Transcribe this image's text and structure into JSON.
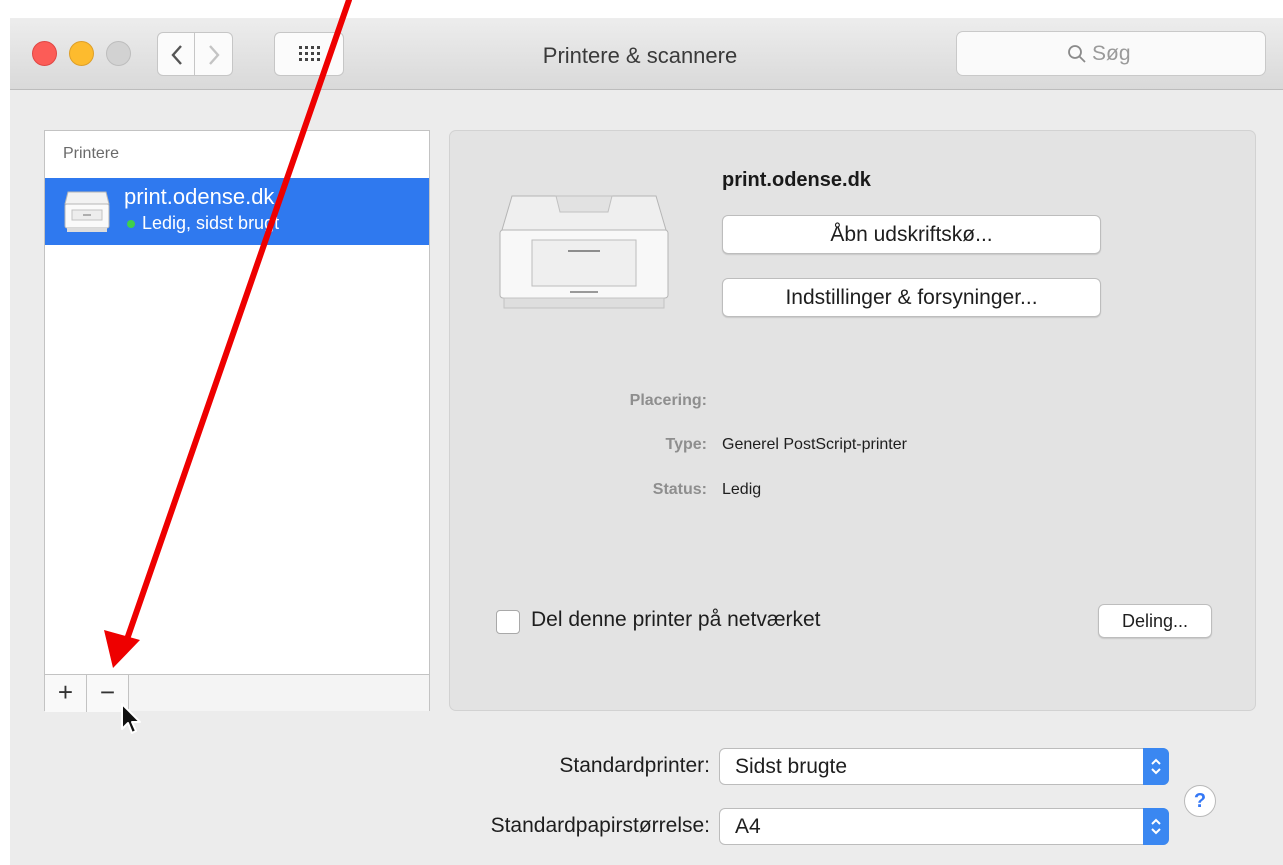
{
  "window": {
    "title": "Printere & scannere",
    "search_placeholder": "Søg"
  },
  "sidebar": {
    "header": "Printere",
    "printers": [
      {
        "name": "print.odense.dk",
        "status": "Ledig, sidst brugt",
        "selected": true
      }
    ],
    "add_label": "+",
    "remove_label": "−"
  },
  "detail": {
    "printer_name": "print.odense.dk",
    "open_queue_label": "Åbn udskriftskø...",
    "options_label": "Indstillinger & forsyninger...",
    "location_label": "Placering:",
    "location_value": "",
    "type_label": "Type:",
    "type_value": "Generel PostScript-printer",
    "status_label": "Status:",
    "status_value": "Ledig",
    "share_checkbox_label": "Del denne printer på netværket",
    "share_checked": false,
    "sharing_button_label": "Deling..."
  },
  "defaults": {
    "default_printer_label": "Standardprinter:",
    "default_printer_value": "Sidst brugte",
    "paper_size_label": "Standardpapirstørrelse:",
    "paper_size_value": "A4",
    "help_label": "?"
  },
  "colors": {
    "selection": "#2f79ef",
    "arrow": "#ee0000",
    "close": "#fc5c57",
    "minimize": "#fdbb2e",
    "status_dot": "#3fd04a"
  }
}
